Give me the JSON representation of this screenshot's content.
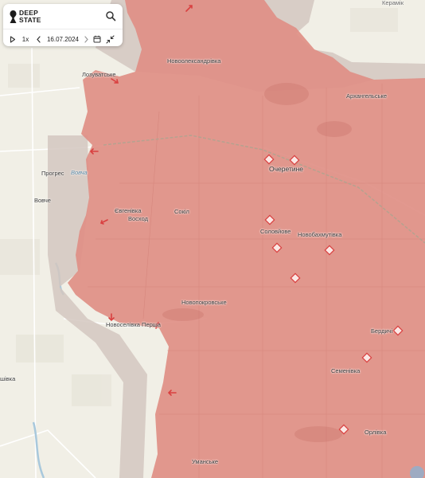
{
  "app": {
    "logo_line1": "DEEP",
    "logo_line2": "STATE"
  },
  "controls": {
    "speed": "1x",
    "date": "16.07.2024",
    "icons": [
      "play-icon",
      "chevron-left-icon",
      "chevron-right-icon",
      "calendar-icon",
      "collapse-arrows-icon",
      "search-icon"
    ]
  },
  "colors": {
    "occupied": "#e08f86",
    "contested": "#d3c7bf",
    "base": "#f1efe6",
    "water": "#a8c8dc",
    "marker": "#d94040"
  },
  "places": {
    "novooleksandrivka": "Новоолександрівка",
    "lozuvatske": "Лозуватське",
    "arkhanhelske": "Архангельське",
    "ocheretyne": "Очеретине",
    "prohres": "Прогрес",
    "vovche_river": "Вовча",
    "vovche": "Вовче",
    "yevhenivka": "Євгенівка",
    "voskhod": "Восход",
    "sokil": "Сокіл",
    "soloviove": "Соловйове",
    "novobakhmutivka": "Новобахмутівка",
    "novopokrovske": "Новопокровське",
    "novoselivka_persha": "Новоселівка Перша",
    "berdychi": "Бердичі",
    "semenivka": "Семенівка",
    "orlivka": "Орлівка",
    "umanske": "Уманське",
    "kalynove": "Калинове",
    "left_edge": "шівка",
    "top_right": "Керамік"
  }
}
